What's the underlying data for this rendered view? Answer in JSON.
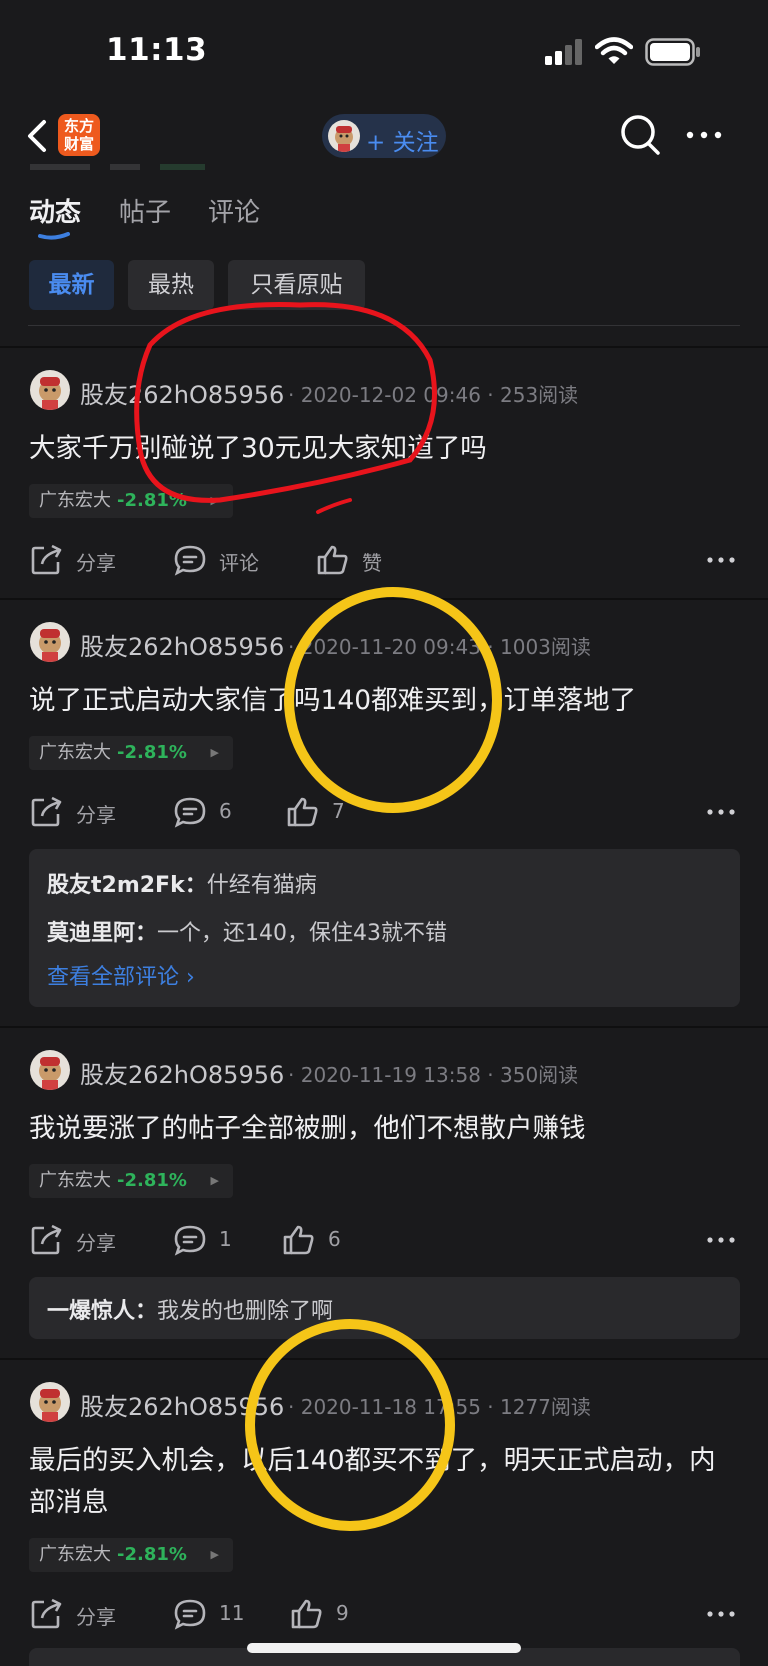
{
  "status": {
    "time": "11:13"
  },
  "nav": {
    "app_logo": "东方\n财富",
    "follow": "+ 关注"
  },
  "tabs": {
    "active": "动态",
    "items": [
      "动态",
      "帖子",
      "评论"
    ]
  },
  "filters": [
    "最新",
    "最热",
    "只看原贴"
  ],
  "posts": [
    {
      "user": "股友262hO85956",
      "meta": "· 2020-12-02 09:46 · 253阅读",
      "text": "大家千万别碰说了30元见大家知道了吗",
      "stock": {
        "name": "广东宏大",
        "change": "-2.81%"
      },
      "actions": {
        "share": "分享",
        "comment": "评论",
        "like": "赞"
      }
    },
    {
      "user": "股友262hO85956",
      "meta": "· 2020-11-20 09:43 · 1003阅读",
      "text": "说了正式启动大家信了吗140都难买到，订单落地了",
      "stock": {
        "name": "广东宏大",
        "change": "-2.81%"
      },
      "actions": {
        "share": "分享",
        "comment": "6",
        "like": "7"
      },
      "comments": [
        {
          "author": "股友t2m2Fk：",
          "text": "什经有猫病"
        },
        {
          "author": "莫迪里阿：",
          "text": "一个，还140，保住43就不错"
        }
      ],
      "view_all": "查看全部评论 ›"
    },
    {
      "user": "股友262hO85956",
      "meta": "· 2020-11-19 13:58 · 350阅读",
      "text": "我说要涨了的帖子全部被删，他们不想散户赚钱",
      "stock": {
        "name": "广东宏大",
        "change": "-2.81%"
      },
      "actions": {
        "share": "分享",
        "comment": "1",
        "like": "6"
      },
      "comments": [
        {
          "author": "一爆惊人：",
          "text": "我发的也删除了啊"
        }
      ]
    },
    {
      "user": "股友262hO85956",
      "meta": "· 2020-11-18 17:55 · 1277阅读",
      "text": "最后的买入机会，以后140都买不到了，明天正式启动，内部消息",
      "stock": {
        "name": "广东宏大",
        "change": "-2.81%"
      },
      "actions": {
        "share": "分享",
        "comment": "11",
        "like": "9"
      }
    }
  ],
  "colors": {
    "background": "#1a1a1c",
    "accent": "#4a8cf0",
    "positive_change": "#2eb35b",
    "annotation_red": "#e8141c",
    "annotation_yellow": "#f5c518"
  }
}
